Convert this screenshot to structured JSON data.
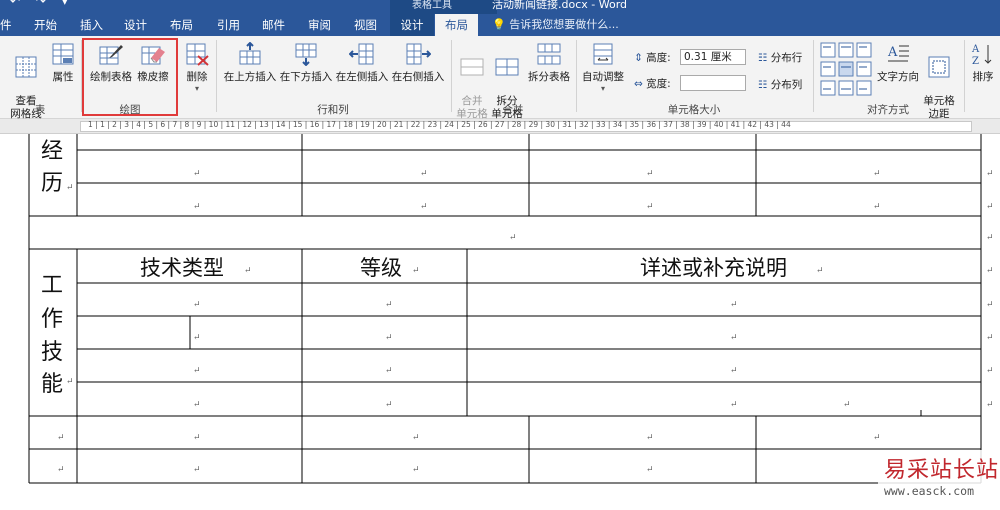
{
  "titlebar": {
    "context_title": "表格工具",
    "document_title": "活动新闻链接.docx - Word",
    "qat": "↶ ↷ ▾"
  },
  "tabs": [
    {
      "label": "开始"
    },
    {
      "label": "插入"
    },
    {
      "label": "设计"
    },
    {
      "label": "布局"
    },
    {
      "label": "引用"
    },
    {
      "label": "邮件"
    },
    {
      "label": "审阅"
    },
    {
      "label": "视图"
    },
    {
      "label": "设计"
    },
    {
      "label": "布局"
    }
  ],
  "tellme": "告诉我您想要做什么...",
  "ribbon": {
    "table_group": {
      "view_gridlines": "查看\n网格线",
      "properties": "属性",
      "label": "表"
    },
    "draw_group": {
      "draw_table": "绘制表格",
      "eraser": "橡皮擦",
      "label": "绘图"
    },
    "delete": "删除",
    "rowscols_group": {
      "insert_above": "在上方插入",
      "insert_below": "在下方插入",
      "insert_left": "在左侧插入",
      "insert_right": "在右侧插入",
      "label": "行和列"
    },
    "merge_group": {
      "merge_cells": "合并\n单元格",
      "split_cells": "拆分\n单元格",
      "split_table": "拆分表格",
      "label": "合并"
    },
    "cellsize_group": {
      "autofit": "自动调整",
      "height_label": "高度:",
      "height_value": "0.31 厘米",
      "width_label": "宽度:",
      "width_value": "",
      "distribute_rows": "分布行",
      "distribute_cols": "分布列",
      "label": "单元格大小"
    },
    "align_group": {
      "text_direction": "文字方向",
      "cell_margins": "单元格\n边距",
      "label": "对齐方式"
    },
    "sort": "排序"
  },
  "ruler": {
    "numbers": "1  | 1  |  2 | 3 | 4 | 5 | 6 | 7 | 8 | 9 | 10 | 11 | 12 | 13 | 14 | 15 | 16 | 17 | 18 | 19 | 20 | 21 | 22 | 23 | 24 | 25 | 26 | 27 | 28 | 29 | 30 | 31 | 32 | 33 | 34 | 35 | 36 | 37 | 38 | 39 | 40 | 41 | 42 | 43 | 44"
  },
  "table": {
    "resume_label_line1": "经",
    "resume_label_line2": "历",
    "work_skills_label": [
      "工",
      "作",
      "技",
      "能"
    ],
    "headers": {
      "tech_type": "技术类型",
      "level": "等级",
      "details": "详述或补充说明"
    },
    "para_mark": "↵"
  },
  "watermark": {
    "brand": "易采站长站",
    "url": "www.easck.com"
  }
}
